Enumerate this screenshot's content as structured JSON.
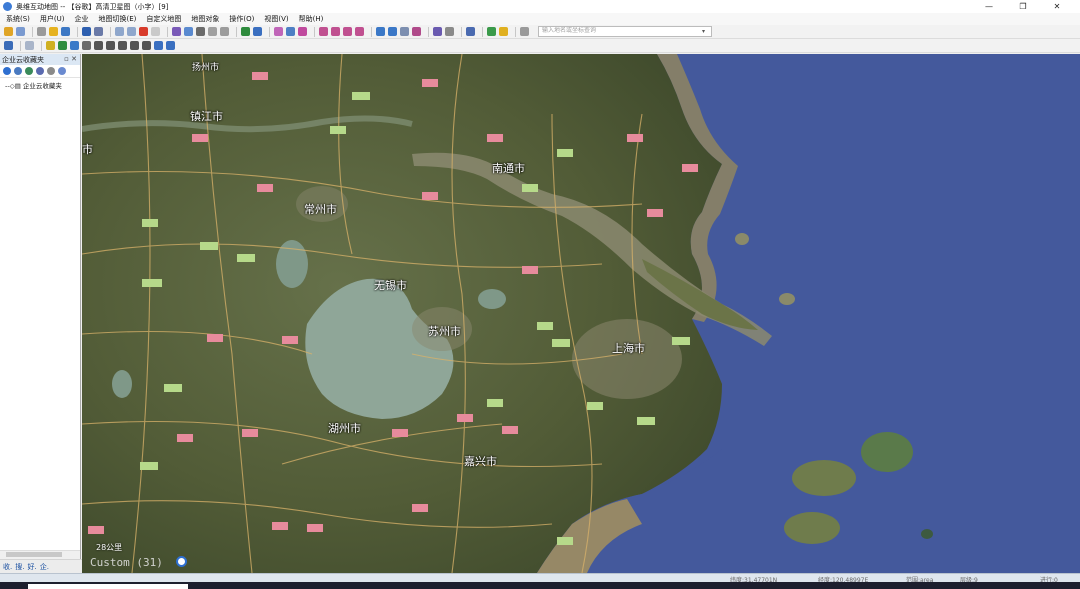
{
  "window": {
    "title": "奥维互动地图 -- 【谷歌】高清卫星图（小字）[9]",
    "controls": [
      "—",
      "❐",
      "✕"
    ]
  },
  "menu": [
    "系统(S)",
    "用户(U)",
    "企业",
    "地图切换(E)",
    "自定义地图",
    "地图对象",
    "操作(O)",
    "视图(V)",
    "帮助(H)"
  ],
  "search": {
    "placeholder": "输入地名或坐标查询",
    "dropdown": "▾"
  },
  "panel": {
    "title": "企业云收藏夹",
    "controls": "▫ ✕",
    "tree_item": "--◇▤ 企业云收藏夹",
    "footer": [
      "收.",
      "搜.",
      "好.",
      "企."
    ]
  },
  "map": {
    "scale_label": "28公里",
    "layer_label": "Custom (31)",
    "cities": [
      "扬州市",
      "镇江市",
      "南通市",
      "常州市",
      "无锡市",
      "苏州市",
      "上海市",
      "湖州市",
      "嘉兴市",
      "市"
    ]
  },
  "status": {
    "lng": "纬度:31.47701N",
    "lat": "经度:120.48997E",
    "area": "范围:area",
    "level": "层级:9",
    "progress": "进行:0"
  },
  "colors": {
    "sea": "#44599c",
    "land": "#55603c",
    "lake": "#8fa698",
    "mud": "#9a8a62",
    "road": "#d9b26a"
  }
}
